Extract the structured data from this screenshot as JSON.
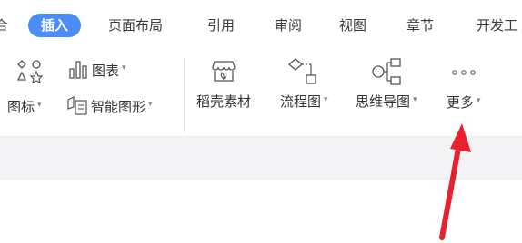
{
  "tabs": {
    "cut_left": "合",
    "insert": "插入",
    "page_layout": "页面布局",
    "references": "引用",
    "review": "审阅",
    "view": "视图",
    "sections": "章节",
    "developer": "开发工"
  },
  "ribbon": {
    "chart": "图表",
    "icons": "图标",
    "smartart": "智能图形",
    "straw_material": "稻壳素材",
    "flowchart": "流程图",
    "mindmap": "思维导图",
    "more": "更多"
  },
  "colors": {
    "active_tab": "#4a8df8",
    "arrow": "#e8212e"
  }
}
